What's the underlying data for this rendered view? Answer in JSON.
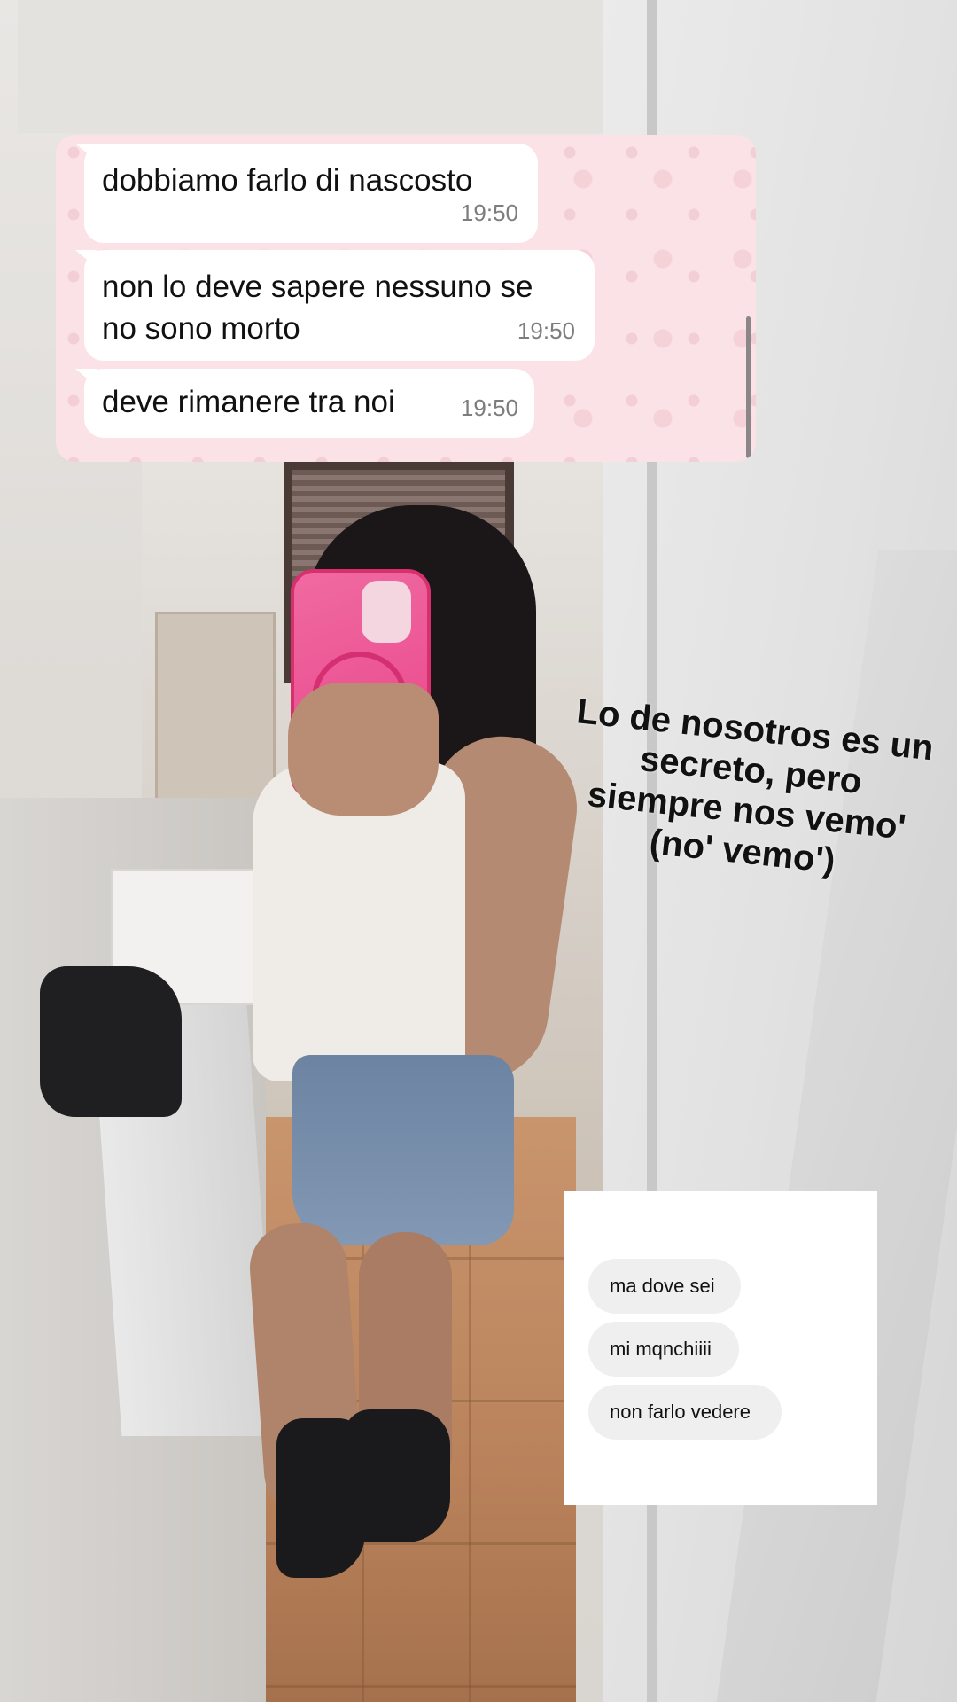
{
  "whatsapp_chat": {
    "messages": [
      {
        "text": "dobbiamo farlo di nascosto",
        "time": "19:50"
      },
      {
        "text": "non lo deve sapere nessuno se no sono morto",
        "line1": "non lo deve sapere nessuno se",
        "line2": "no sono morto",
        "time": "19:50"
      },
      {
        "text": "deve rimanere tra noi",
        "time": "19:50"
      }
    ],
    "background_color": "#fbe2e6"
  },
  "story_text": {
    "lines": [
      "Lo de nosotros es un",
      "secreto, pero",
      "siempre nos vemo'",
      "(no' vemo')"
    ]
  },
  "dm_chat": {
    "messages": [
      {
        "text": "ma dove sei"
      },
      {
        "text": "mi mqnchiiii"
      },
      {
        "text": "non farlo vedere"
      }
    ]
  }
}
